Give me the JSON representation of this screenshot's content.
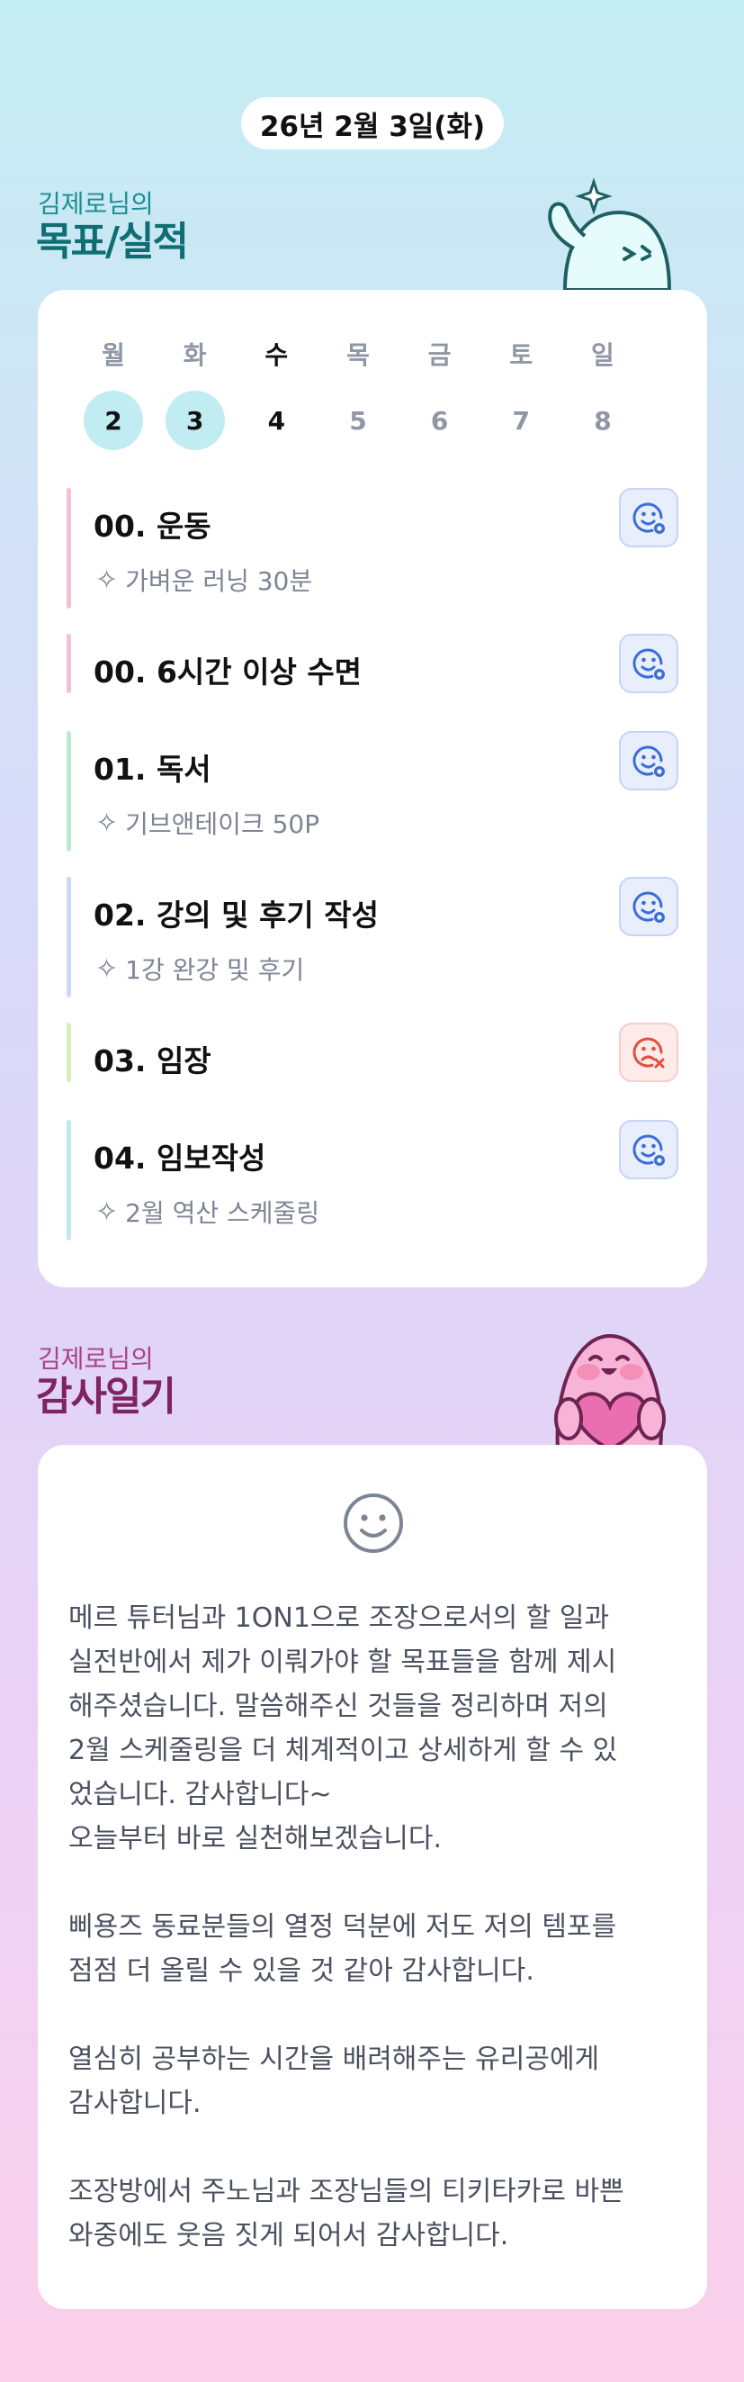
{
  "date": "26년 2월 3일(화)",
  "goals_section": {
    "owner": "김제로님의",
    "title": "목표/실적"
  },
  "week": {
    "days": [
      {
        "name": "월",
        "num": "2",
        "state": "done"
      },
      {
        "name": "화",
        "num": "3",
        "state": "done"
      },
      {
        "name": "수",
        "num": "4",
        "state": "today"
      },
      {
        "name": "목",
        "num": "5",
        "state": "future"
      },
      {
        "name": "금",
        "num": "6",
        "state": "future"
      },
      {
        "name": "토",
        "num": "7",
        "state": "future"
      },
      {
        "name": "일",
        "num": "8",
        "state": "future"
      }
    ]
  },
  "goals": [
    {
      "title": "00. 운동",
      "detail": "가벼운 러닝 30분",
      "status": "achieved",
      "icon": "smile-check-icon",
      "color": "#f6bfd9"
    },
    {
      "title": "00. 6시간 이상 수면",
      "detail": "",
      "status": "achieved",
      "icon": "smile-check-icon",
      "color": "#f6bfd9"
    },
    {
      "title": "01. 독서",
      "detail": "기브앤테이크 50P",
      "status": "achieved",
      "icon": "smile-check-icon",
      "color": "#b9ecd7"
    },
    {
      "title": "02. 강의 및 후기 작성",
      "detail": "1강 완강 및 후기",
      "status": "achieved",
      "icon": "smile-check-icon",
      "color": "#cfd9f7"
    },
    {
      "title": "03. 임장",
      "detail": "",
      "status": "missed",
      "icon": "sad-x-icon",
      "color": "#d8f0b6"
    },
    {
      "title": "04. 임보작성",
      "detail": "2월 역산 스케줄링",
      "status": "achieved",
      "icon": "smile-check-icon",
      "color": "#bfe9f0"
    }
  ],
  "gratitude_section": {
    "owner": "김제로님의",
    "title": "감사일기"
  },
  "gratitude": {
    "icon": "smile-icon",
    "paragraphs": [
      "메르 튜터님과 1ON1으로 조장으로서의 할 일과\n실전반에서 제가 이뤄가야 할 목표들을 함께 제시\n해주셨습니다. 말씀해주신 것들을 정리하며 저의\n2월 스케줄링을 더 체계적이고 상세하게 할 수 있\n었습니다. 감사합니다~\n오늘부터 바로 실천해보겠습니다.",
      "삐용즈 동료분들의 열정 덕분에 저도 저의 템포를\n점점 더 올릴 수 있을 것 같아 감사합니다.",
      "열심히 공부하는 시간을 배려해주는 유리공에게\n감사합니다.",
      "조장방에서 주노님과 조장님들의 티키타카로 바쁜\n와중에도 웃음 짓게 되어서 감사합니다."
    ]
  },
  "colors": {
    "goal_title": "#0f6e72",
    "gratitude_title": "#7e2363",
    "good": "#3b6fd6",
    "bad": "#e0503c"
  }
}
